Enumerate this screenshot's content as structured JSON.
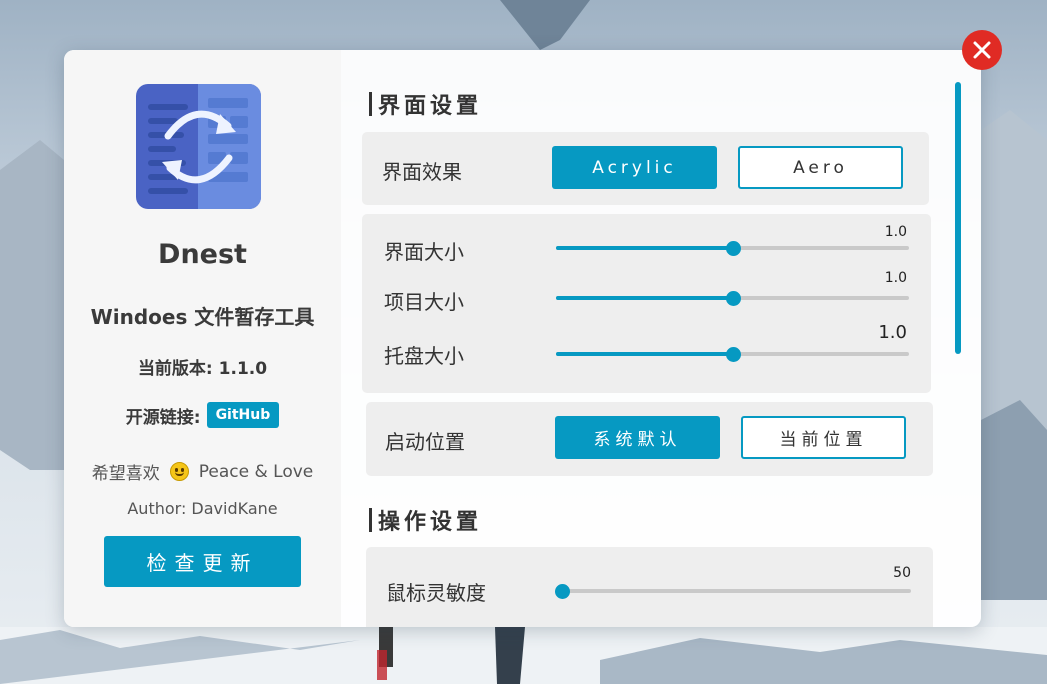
{
  "app": {
    "name": "Dnest",
    "description": "Windoes 文件暂存工具",
    "version_label": "当前版本: 1.1.0",
    "opensource_label": "开源链接:",
    "github_label": "GitHub",
    "wish_text": "希望喜欢",
    "wish_icon": "smiley-icon",
    "motto": "Peace & Love",
    "author": "Author: DavidKane",
    "check_update_label": "检查更新"
  },
  "ui_settings": {
    "title": "界面设置",
    "effect": {
      "label": "界面效果",
      "options": [
        "Acrylic",
        "Aero"
      ],
      "selected": "Acrylic"
    },
    "sliders": [
      {
        "label": "界面大小",
        "value_text": "1.0",
        "value": 1.0,
        "fraction": 0.5
      },
      {
        "label": "项目大小",
        "value_text": "1.0",
        "value": 1.0,
        "fraction": 0.5
      },
      {
        "label": "托盘大小",
        "value_text": "1.0",
        "value": 1.0,
        "fraction": 0.5
      }
    ],
    "startup": {
      "label": "启动位置",
      "options": [
        "系统默认",
        "当前位置"
      ],
      "selected": "系统默认"
    }
  },
  "op_settings": {
    "title": "操作设置",
    "sliders": [
      {
        "label": "鼠标灵敏度",
        "value_text": "50",
        "value": 50,
        "fraction": 0.0
      }
    ]
  },
  "colors": {
    "accent": "#0699c2",
    "close": "#e02b24"
  },
  "icons": {
    "close": "close-icon",
    "app": "sync-file-icon"
  }
}
